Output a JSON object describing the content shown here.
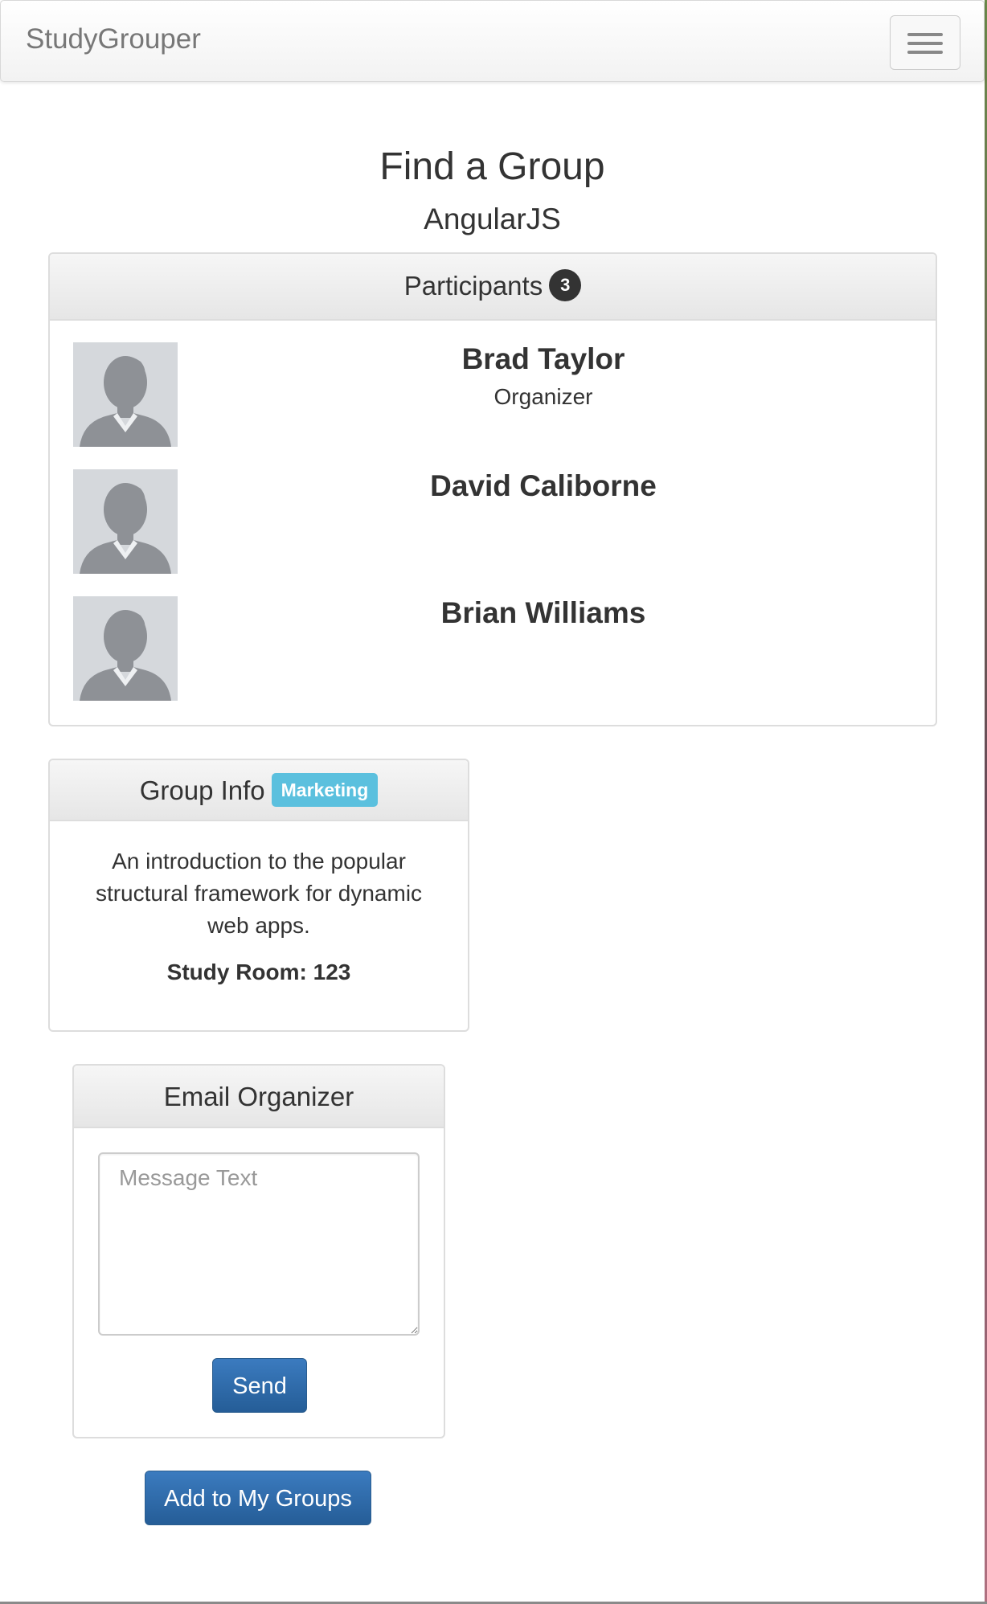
{
  "navbar": {
    "brand": "StudyGrouper",
    "menu_icon": "hamburger-menu-icon"
  },
  "page": {
    "title": "Find a Group",
    "subtitle": "AngularJS"
  },
  "participants": {
    "heading": "Participants",
    "count": "3",
    "list": [
      {
        "name": "Brad Taylor",
        "role": "Organizer",
        "avatar_icon": "default-user-avatar-icon"
      },
      {
        "name": "David Caliborne",
        "role": "",
        "avatar_icon": "default-user-avatar-icon"
      },
      {
        "name": "Brian Williams",
        "role": "",
        "avatar_icon": "default-user-avatar-icon"
      }
    ]
  },
  "group_info": {
    "heading": "Group Info",
    "category": "Marketing",
    "description": "An introduction to the popular structural framework for dynamic web apps.",
    "room": "Study Room: 123"
  },
  "email_organizer": {
    "heading": "Email Organizer",
    "message_placeholder": "Message Text",
    "message_value": "",
    "send_label": "Send"
  },
  "actions": {
    "add_label": "Add to My Groups"
  },
  "colors": {
    "primary_button": "#2e6da4",
    "badge": "#333333",
    "label_info": "#5bc0de"
  }
}
